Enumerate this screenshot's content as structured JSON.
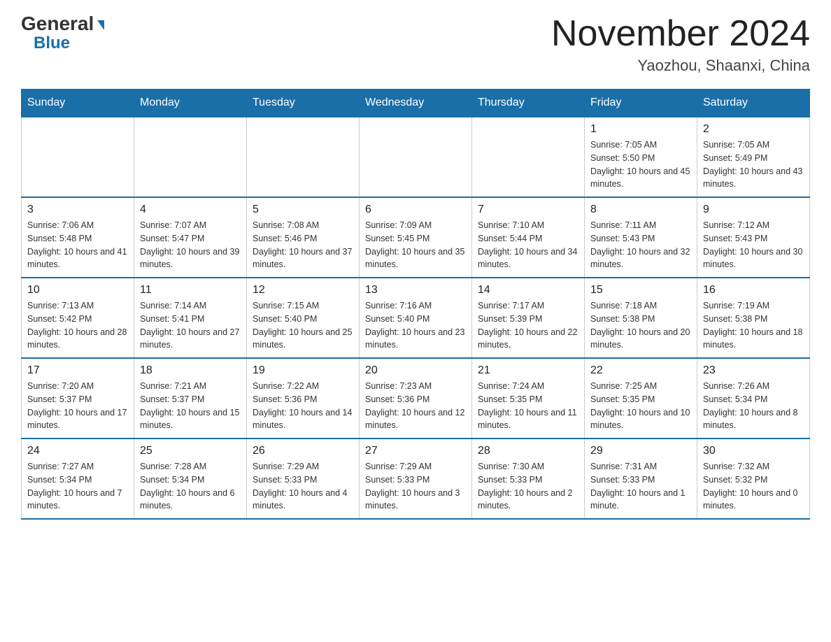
{
  "header": {
    "logo_general": "General",
    "logo_blue": "Blue",
    "month_title": "November 2024",
    "location": "Yaozhou, Shaanxi, China"
  },
  "weekdays": [
    "Sunday",
    "Monday",
    "Tuesday",
    "Wednesday",
    "Thursday",
    "Friday",
    "Saturday"
  ],
  "weeks": [
    [
      {
        "day": "",
        "info": ""
      },
      {
        "day": "",
        "info": ""
      },
      {
        "day": "",
        "info": ""
      },
      {
        "day": "",
        "info": ""
      },
      {
        "day": "",
        "info": ""
      },
      {
        "day": "1",
        "info": "Sunrise: 7:05 AM\nSunset: 5:50 PM\nDaylight: 10 hours and 45 minutes."
      },
      {
        "day": "2",
        "info": "Sunrise: 7:05 AM\nSunset: 5:49 PM\nDaylight: 10 hours and 43 minutes."
      }
    ],
    [
      {
        "day": "3",
        "info": "Sunrise: 7:06 AM\nSunset: 5:48 PM\nDaylight: 10 hours and 41 minutes."
      },
      {
        "day": "4",
        "info": "Sunrise: 7:07 AM\nSunset: 5:47 PM\nDaylight: 10 hours and 39 minutes."
      },
      {
        "day": "5",
        "info": "Sunrise: 7:08 AM\nSunset: 5:46 PM\nDaylight: 10 hours and 37 minutes."
      },
      {
        "day": "6",
        "info": "Sunrise: 7:09 AM\nSunset: 5:45 PM\nDaylight: 10 hours and 35 minutes."
      },
      {
        "day": "7",
        "info": "Sunrise: 7:10 AM\nSunset: 5:44 PM\nDaylight: 10 hours and 34 minutes."
      },
      {
        "day": "8",
        "info": "Sunrise: 7:11 AM\nSunset: 5:43 PM\nDaylight: 10 hours and 32 minutes."
      },
      {
        "day": "9",
        "info": "Sunrise: 7:12 AM\nSunset: 5:43 PM\nDaylight: 10 hours and 30 minutes."
      }
    ],
    [
      {
        "day": "10",
        "info": "Sunrise: 7:13 AM\nSunset: 5:42 PM\nDaylight: 10 hours and 28 minutes."
      },
      {
        "day": "11",
        "info": "Sunrise: 7:14 AM\nSunset: 5:41 PM\nDaylight: 10 hours and 27 minutes."
      },
      {
        "day": "12",
        "info": "Sunrise: 7:15 AM\nSunset: 5:40 PM\nDaylight: 10 hours and 25 minutes."
      },
      {
        "day": "13",
        "info": "Sunrise: 7:16 AM\nSunset: 5:40 PM\nDaylight: 10 hours and 23 minutes."
      },
      {
        "day": "14",
        "info": "Sunrise: 7:17 AM\nSunset: 5:39 PM\nDaylight: 10 hours and 22 minutes."
      },
      {
        "day": "15",
        "info": "Sunrise: 7:18 AM\nSunset: 5:38 PM\nDaylight: 10 hours and 20 minutes."
      },
      {
        "day": "16",
        "info": "Sunrise: 7:19 AM\nSunset: 5:38 PM\nDaylight: 10 hours and 18 minutes."
      }
    ],
    [
      {
        "day": "17",
        "info": "Sunrise: 7:20 AM\nSunset: 5:37 PM\nDaylight: 10 hours and 17 minutes."
      },
      {
        "day": "18",
        "info": "Sunrise: 7:21 AM\nSunset: 5:37 PM\nDaylight: 10 hours and 15 minutes."
      },
      {
        "day": "19",
        "info": "Sunrise: 7:22 AM\nSunset: 5:36 PM\nDaylight: 10 hours and 14 minutes."
      },
      {
        "day": "20",
        "info": "Sunrise: 7:23 AM\nSunset: 5:36 PM\nDaylight: 10 hours and 12 minutes."
      },
      {
        "day": "21",
        "info": "Sunrise: 7:24 AM\nSunset: 5:35 PM\nDaylight: 10 hours and 11 minutes."
      },
      {
        "day": "22",
        "info": "Sunrise: 7:25 AM\nSunset: 5:35 PM\nDaylight: 10 hours and 10 minutes."
      },
      {
        "day": "23",
        "info": "Sunrise: 7:26 AM\nSunset: 5:34 PM\nDaylight: 10 hours and 8 minutes."
      }
    ],
    [
      {
        "day": "24",
        "info": "Sunrise: 7:27 AM\nSunset: 5:34 PM\nDaylight: 10 hours and 7 minutes."
      },
      {
        "day": "25",
        "info": "Sunrise: 7:28 AM\nSunset: 5:34 PM\nDaylight: 10 hours and 6 minutes."
      },
      {
        "day": "26",
        "info": "Sunrise: 7:29 AM\nSunset: 5:33 PM\nDaylight: 10 hours and 4 minutes."
      },
      {
        "day": "27",
        "info": "Sunrise: 7:29 AM\nSunset: 5:33 PM\nDaylight: 10 hours and 3 minutes."
      },
      {
        "day": "28",
        "info": "Sunrise: 7:30 AM\nSunset: 5:33 PM\nDaylight: 10 hours and 2 minutes."
      },
      {
        "day": "29",
        "info": "Sunrise: 7:31 AM\nSunset: 5:33 PM\nDaylight: 10 hours and 1 minute."
      },
      {
        "day": "30",
        "info": "Sunrise: 7:32 AM\nSunset: 5:32 PM\nDaylight: 10 hours and 0 minutes."
      }
    ]
  ]
}
